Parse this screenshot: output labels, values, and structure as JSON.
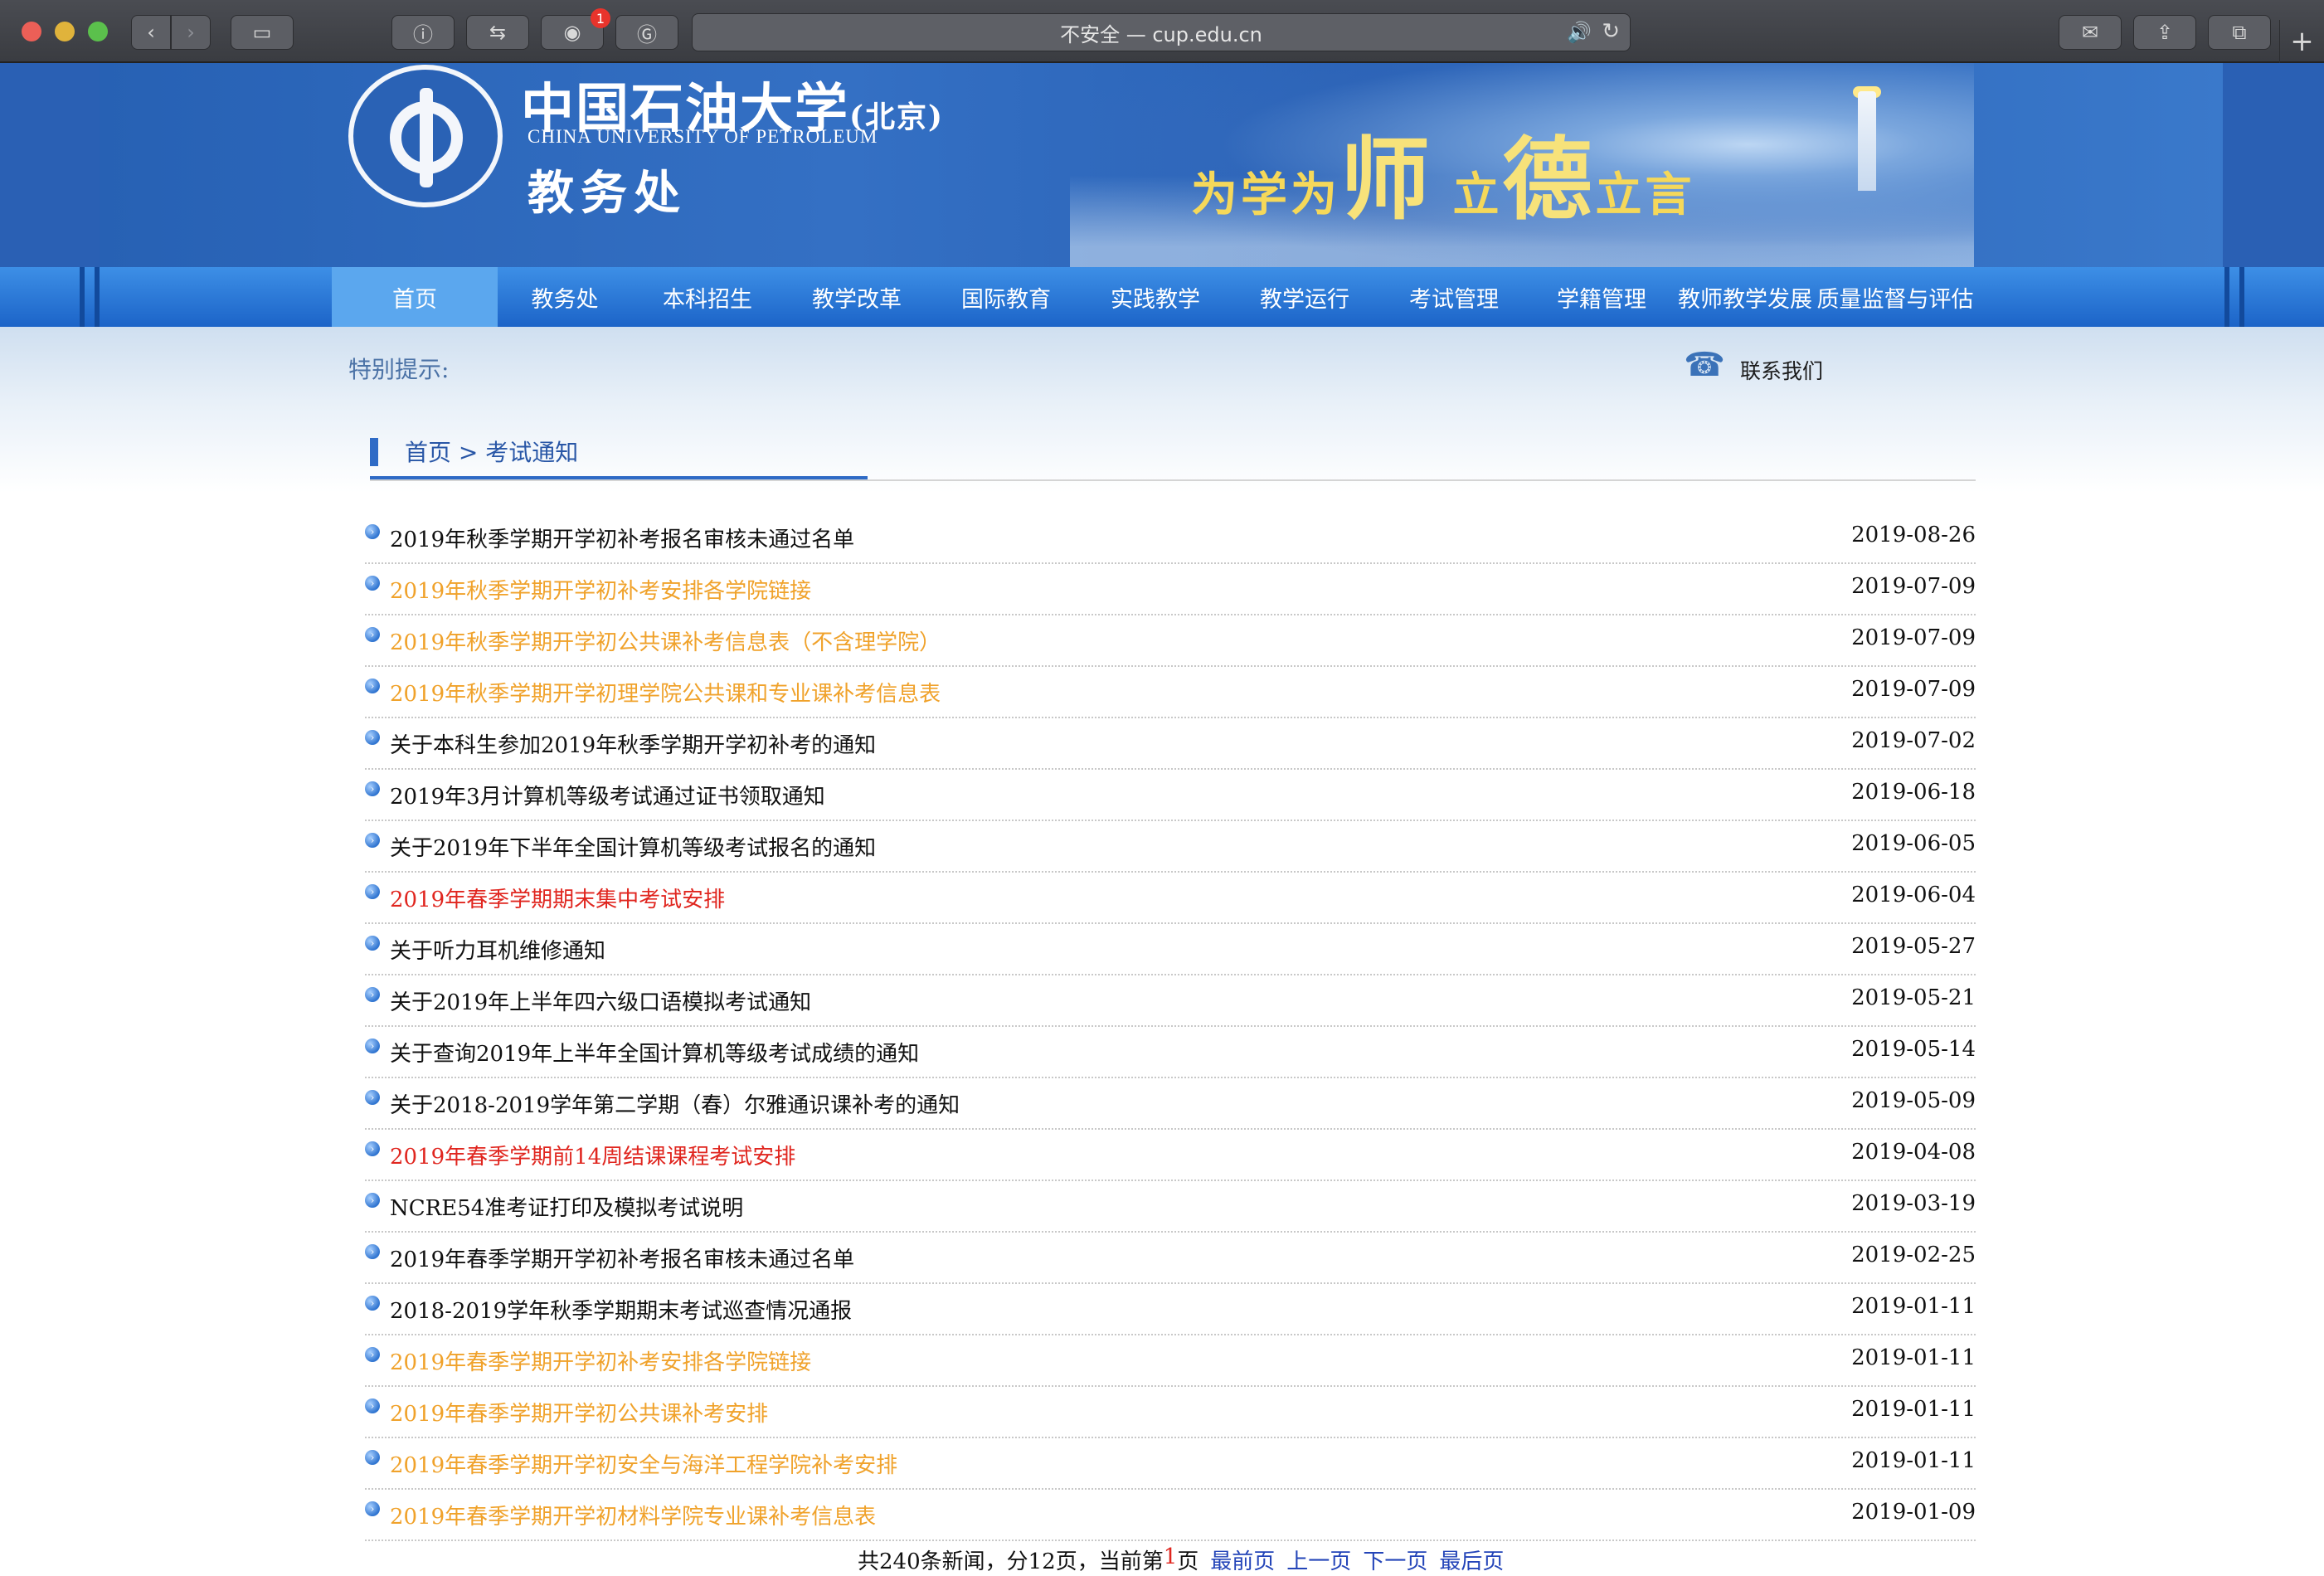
{
  "browser": {
    "url_text": "不安全 — cup.edu.cn",
    "extension_badge": "1",
    "icons": {
      "back": "chevron-left-icon",
      "forward": "chevron-right-icon",
      "sidebar": "sidebar-icon",
      "info": "info-icon",
      "swap": "swap-icon",
      "extension": "extension-icon",
      "grammarly": "grammarly-icon",
      "speaker": "speaker-icon",
      "reload": "reload-icon",
      "mail": "mail-icon",
      "share": "share-icon",
      "tabs": "tabs-icon",
      "new_tab": "plus-icon"
    }
  },
  "header": {
    "school_name_cn": "中国石油大学",
    "school_campus": "(北京)",
    "school_name_en": "CHINA UNIVERSITY OF PETROLEUM",
    "office_name": "教务处",
    "slogan_part1": "为学为",
    "slogan_big1": "师",
    "slogan_part2": "立",
    "slogan_big2": "德",
    "slogan_part3": "立言"
  },
  "nav": {
    "items": [
      {
        "label": "首页",
        "active": true
      },
      {
        "label": "教务处"
      },
      {
        "label": "本科招生"
      },
      {
        "label": "教学改革"
      },
      {
        "label": "国际教育"
      },
      {
        "label": "实践教学"
      },
      {
        "label": "教学运行"
      },
      {
        "label": "考试管理"
      },
      {
        "label": "学籍管理"
      },
      {
        "label": "教师教学发展"
      },
      {
        "label": "质量监督与评估"
      }
    ]
  },
  "notice": {
    "label": "特别提示:",
    "contact_label": "联系我们"
  },
  "breadcrumb": {
    "text": "首页 > 考试通知"
  },
  "news": [
    {
      "title": "2019年秋季学期开学初补考报名审核未通过名单",
      "date": "2019-08-26",
      "color": "black"
    },
    {
      "title": "2019年秋季学期开学初补考安排各学院链接",
      "date": "2019-07-09",
      "color": "orange"
    },
    {
      "title": "2019年秋季学期开学初公共课补考信息表（不含理学院）",
      "date": "2019-07-09",
      "color": "orange"
    },
    {
      "title": "2019年秋季学期开学初理学院公共课和专业课补考信息表",
      "date": "2019-07-09",
      "color": "orange"
    },
    {
      "title": "关于本科生参加2019年秋季学期开学初补考的通知",
      "date": "2019-07-02",
      "color": "black"
    },
    {
      "title": "2019年3月计算机等级考试通过证书领取通知",
      "date": "2019-06-18",
      "color": "black"
    },
    {
      "title": "关于2019年下半年全国计算机等级考试报名的通知",
      "date": "2019-06-05",
      "color": "black"
    },
    {
      "title": "2019年春季学期期末集中考试安排",
      "date": "2019-06-04",
      "color": "red"
    },
    {
      "title": "关于听力耳机维修通知",
      "date": "2019-05-27",
      "color": "black"
    },
    {
      "title": "关于2019年上半年四六级口语模拟考试通知",
      "date": "2019-05-21",
      "color": "black"
    },
    {
      "title": "关于查询2019年上半年全国计算机等级考试成绩的通知",
      "date": "2019-05-14",
      "color": "black"
    },
    {
      "title": "关于2018-2019学年第二学期（春）尔雅通识课补考的通知",
      "date": "2019-05-09",
      "color": "black"
    },
    {
      "title": "2019年春季学期前14周结课课程考试安排",
      "date": "2019-04-08",
      "color": "red"
    },
    {
      "title": "NCRE54准考证打印及模拟考试说明",
      "date": "2019-03-19",
      "color": "black"
    },
    {
      "title": "2019年春季学期开学初补考报名审核未通过名单",
      "date": "2019-02-25",
      "color": "black"
    },
    {
      "title": "2018-2019学年秋季学期期末考试巡查情况通报",
      "date": "2019-01-11",
      "color": "black"
    },
    {
      "title": "2019年春季学期开学初补考安排各学院链接",
      "date": "2019-01-11",
      "color": "orange"
    },
    {
      "title": "2019年春季学期开学初公共课补考安排",
      "date": "2019-01-11",
      "color": "orange"
    },
    {
      "title": "2019年春季学期开学初安全与海洋工程学院补考安排",
      "date": "2019-01-11",
      "color": "orange"
    },
    {
      "title": "2019年春季学期开学初材料学院专业课补考信息表",
      "date": "2019-01-09",
      "color": "orange"
    }
  ],
  "pager": {
    "summary_prefix": "共240条新闻，分12页，当前第",
    "current_page": "1",
    "summary_suffix": "页",
    "first": "最前页",
    "prev": "上一页",
    "next": "下一页",
    "last": "最后页"
  },
  "colors": {
    "nav_active": "#5ba7ee",
    "nav_bg": "#1c64c8",
    "link_orange": "#f0a22b",
    "link_red": "#e0261f",
    "pager_link": "#2344b8"
  }
}
